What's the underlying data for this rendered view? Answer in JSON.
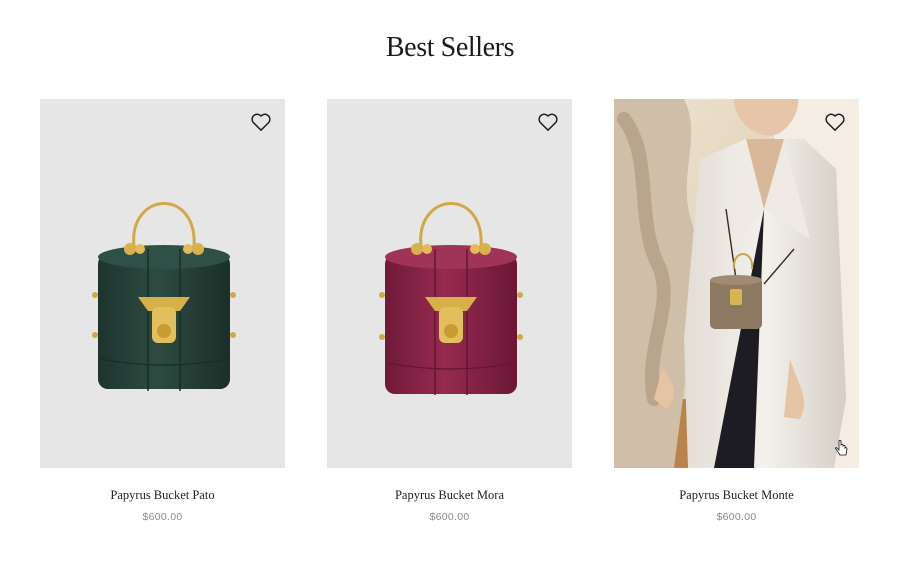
{
  "section": {
    "title": "Best Sellers"
  },
  "products": [
    {
      "name": "Papyrus Bucket Pato",
      "price": "$600.00",
      "color": "#26423a"
    },
    {
      "name": "Papyrus Bucket Mora",
      "price": "$600.00",
      "color": "#8b2448"
    },
    {
      "name": "Papyrus Bucket Monte",
      "price": "$600.00",
      "color": "#8a7560"
    }
  ],
  "icons": {
    "wishlist": "heart-icon",
    "cursor": "hand-cursor-icon"
  }
}
